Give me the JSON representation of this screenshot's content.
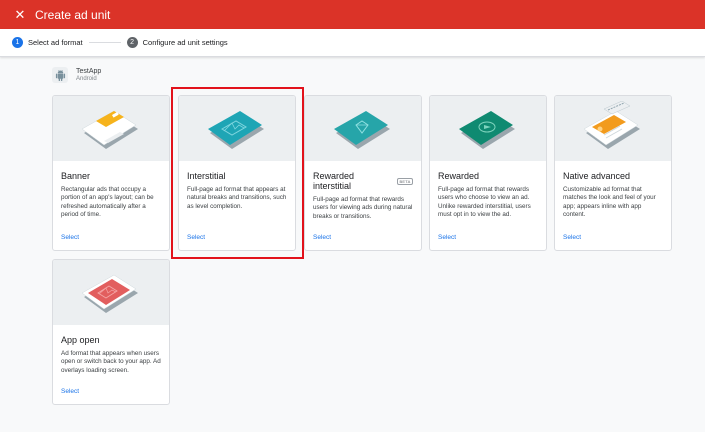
{
  "header": {
    "close_icon": "close-icon",
    "title": "Create ad unit"
  },
  "stepper": {
    "steps": [
      {
        "number": "1",
        "label": "Select ad format"
      },
      {
        "number": "2",
        "label": "Configure ad unit settings"
      }
    ]
  },
  "app": {
    "name": "TestApp",
    "platform": "Android",
    "icon": "android-icon"
  },
  "formats": [
    {
      "title": "Banner",
      "badge": "",
      "description": "Rectangular ads that occupy a portion of an app's layout; can be refreshed automatically after a period of time.",
      "select": "Select",
      "illustration_color": "#f6b31c"
    },
    {
      "title": "Interstitial",
      "badge": "",
      "description": "Full-page ad format that appears at natural breaks and transitions, such as level completion.",
      "select": "Select",
      "illustration_color": "#1ea5b5"
    },
    {
      "title": "Rewarded interstitial",
      "badge": "BETA",
      "description": "Full-page ad format that rewards users for viewing ads during natural breaks or transitions.",
      "select": "Select",
      "illustration_color": "#26a5a9"
    },
    {
      "title": "Rewarded",
      "badge": "",
      "description": "Full-page ad format that rewards users who choose to view an ad. Unlike rewarded interstitial, users must opt in to view the ad.",
      "select": "Select",
      "illustration_color": "#0f8a71"
    },
    {
      "title": "Native advanced",
      "badge": "",
      "description": "Customizable ad format that matches the look and feel of your app; appears inline with app content.",
      "select": "Select",
      "illustration_color": "#f29b1d"
    },
    {
      "title": "App open",
      "badge": "",
      "description": "Ad format that appears when users open or switch back to your app. Ad overlays loading screen.",
      "select": "Select",
      "illustration_color": "#e25e5e"
    }
  ],
  "colors": {
    "header_bg": "#db3328",
    "accent": "#1a73e8",
    "highlight_box": "#e2121b"
  }
}
